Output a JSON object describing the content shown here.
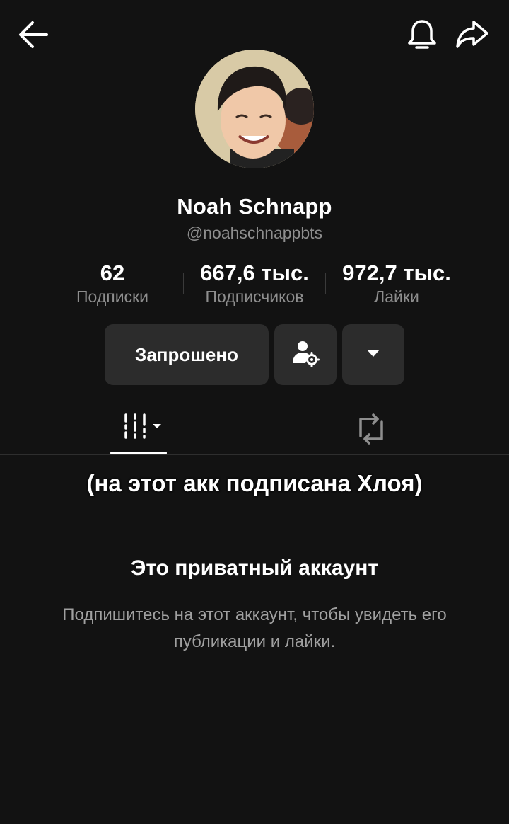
{
  "header": {
    "back_icon": "arrow-left-icon",
    "notify_icon": "bell-icon",
    "share_icon": "share-arrow-icon"
  },
  "profile": {
    "name": "Noah Schnapp",
    "handle": "@noahschnappbts"
  },
  "stats": [
    {
      "value": "62",
      "label": "Подписки"
    },
    {
      "value": "667,6 тыс.",
      "label": "Подписчиков"
    },
    {
      "value": "972,7 тыс.",
      "label": "Лайки"
    }
  ],
  "actions": {
    "requested_label": "Запрошено",
    "user_settings_icon": "user-gear-icon",
    "more_icon": "caret-down-icon"
  },
  "tabs": [
    {
      "icon": "videos-grid-icon",
      "active": true
    },
    {
      "icon": "repost-icon",
      "active": false
    }
  ],
  "overlay_caption": "(на этот акк подписана Хлоя)",
  "private": {
    "title": "Это приватный аккаунт",
    "description": "Подпишитесь на этот аккаунт, чтобы увидеть его публикации и лайки."
  },
  "colors": {
    "background": "#121212",
    "button_bg": "#2c2c2c",
    "secondary_text": "#8e8e8e"
  }
}
